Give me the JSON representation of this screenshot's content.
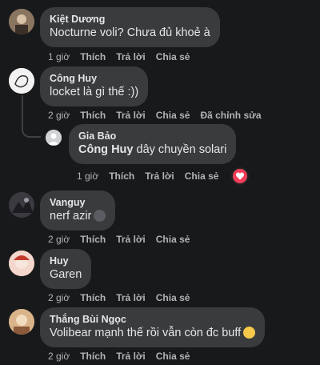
{
  "actions": {
    "like": "Thích",
    "reply": "Trả lời",
    "share": "Chia sẻ",
    "edited": "Đã chỉnh sửa"
  },
  "comments": [
    {
      "author": "Kiệt Dương",
      "text": "Nocturne voli? Chưa đủ khoẻ à",
      "time": "1 giờ"
    },
    {
      "author": "Công Huy",
      "text": "locket là gì thế :))",
      "time": "2 giờ"
    },
    {
      "author": "Vanguy",
      "text": "nerf azir",
      "time": "2 giờ"
    },
    {
      "author": "Huy",
      "text": "Garen",
      "time": "2 giờ"
    },
    {
      "author": "Thắng Bùi Ngọc",
      "text": "Volibear mạnh thế rồi vẫn còn đc buff",
      "time": "2 giờ"
    }
  ],
  "reply": {
    "author": "Gia Bảo",
    "mention": "Công Huy",
    "text": "dây chuyền solari",
    "time": "1 giờ",
    "reaction": "heart-reaction"
  },
  "colors": {
    "bubble": "#3a3b3c",
    "background": "#18191a",
    "reaction": "#f33e58"
  }
}
